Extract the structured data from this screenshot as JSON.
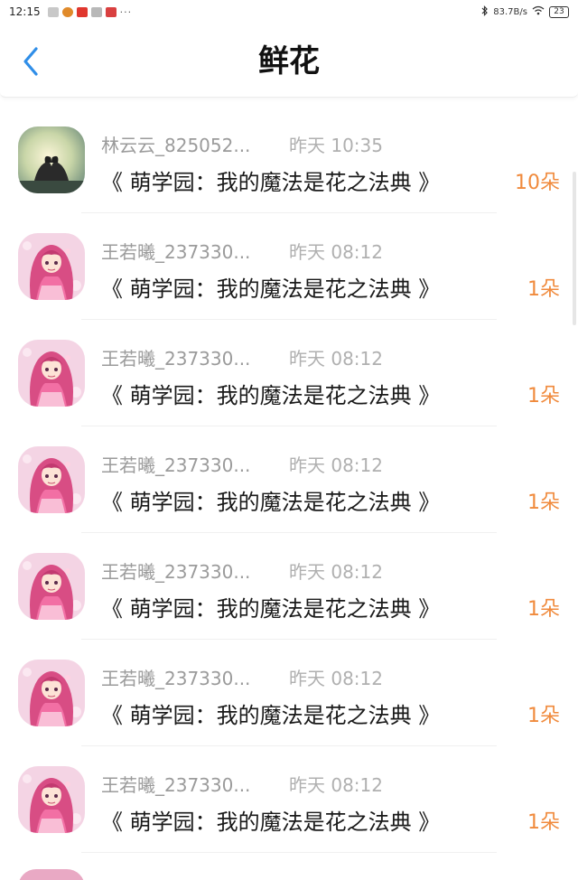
{
  "status_bar": {
    "time": "12:15",
    "more": "···",
    "net_speed": "83.7B/s",
    "battery": "23",
    "app_icon_colors": [
      "#c8c8c8",
      "#e08a2a",
      "#e0372e",
      "#b8b8b8",
      "#d94040"
    ]
  },
  "header": {
    "title": "鲜花",
    "back_icon": "chevron-left-icon",
    "accent": "#2f8ee8"
  },
  "gifts": [
    {
      "sender": "林云云_825052...",
      "time": "昨天 10:35",
      "book": "《 萌学园：我的魔法是花之法典 》",
      "count": "10朵",
      "avatar": "hands-heart"
    },
    {
      "sender": "王若曦_237330...",
      "time": "昨天 08:12",
      "book": "《 萌学园：我的魔法是花之法典 》",
      "count": "1朵",
      "avatar": "anime-girl"
    },
    {
      "sender": "王若曦_237330...",
      "time": "昨天 08:12",
      "book": "《 萌学园：我的魔法是花之法典 》",
      "count": "1朵",
      "avatar": "anime-girl"
    },
    {
      "sender": "王若曦_237330...",
      "time": "昨天 08:12",
      "book": "《 萌学园：我的魔法是花之法典 》",
      "count": "1朵",
      "avatar": "anime-girl"
    },
    {
      "sender": "王若曦_237330...",
      "time": "昨天 08:12",
      "book": "《 萌学园：我的魔法是花之法典 》",
      "count": "1朵",
      "avatar": "anime-girl"
    },
    {
      "sender": "王若曦_237330...",
      "time": "昨天 08:12",
      "book": "《 萌学园：我的魔法是花之法典 》",
      "count": "1朵",
      "avatar": "anime-girl"
    },
    {
      "sender": "王若曦_237330...",
      "time": "昨天 08:12",
      "book": "《 萌学园：我的魔法是花之法典 》",
      "count": "1朵",
      "avatar": "anime-girl"
    }
  ],
  "colors": {
    "count": "#f08a3c",
    "meta": "#9b9b9b"
  }
}
